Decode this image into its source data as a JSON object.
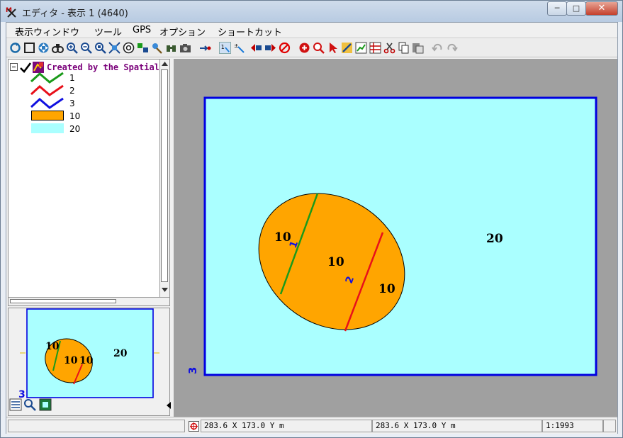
{
  "window": {
    "title": "エディタ - 表示 1 (4640)",
    "minimize": "─",
    "maximize": "□",
    "close": "✕"
  },
  "menubar": {
    "items": [
      "表示ウィンドウ",
      "ツール",
      "GPS",
      "オプション",
      "ショートカット"
    ]
  },
  "toolbar": {
    "icons": [
      "redraw-icon",
      "full-extent-icon",
      "pan-icon",
      "binoculars-icon",
      "zoom-in-icon",
      "zoom-out-icon",
      "zoom-box-icon",
      "zoom-layer-icon",
      "globe-icon",
      "measure-icon",
      "tool-icon",
      "find-icon",
      "camera-icon",
      "gps-icon",
      "select-icon",
      "move-label-icon",
      "previous-icon",
      "next-icon",
      "cancel-icon",
      "zoom-in-red-icon",
      "zoom-out-red-icon",
      "pointer-icon",
      "edit-icon",
      "chart-icon",
      "table-icon",
      "cut-icon",
      "copy-icon",
      "paste-icon",
      "undo-icon",
      "redo-icon"
    ]
  },
  "legend": {
    "layer_title": "Created by the Spatial E",
    "items": [
      {
        "label": "1",
        "color": "#1a9a1a",
        "kind": "line"
      },
      {
        "label": "2",
        "color": "#e8101a",
        "kind": "line"
      },
      {
        "label": "3",
        "color": "#1010e0",
        "kind": "line"
      },
      {
        "label": "10",
        "color": "#ffa500",
        "kind": "fill"
      },
      {
        "label": "20",
        "color": "#aaffff",
        "kind": "fill"
      }
    ]
  },
  "map": {
    "background_color": "#aaffff",
    "ellipse_color": "#ffa500",
    "border_color": "#0000e0",
    "labels": {
      "outer": "20",
      "left_piece": "10",
      "middle_piece": "10",
      "right_piece": "10",
      "node_a": "1",
      "node_b": "2",
      "node_c": "3"
    }
  },
  "overview": {
    "labels": {
      "outer": "20",
      "left_piece": "10",
      "middle_piece": "10",
      "right_piece": "10",
      "node_c": "3"
    }
  },
  "status": {
    "coord1": "283.6 X  173.0 Y m",
    "coord2": "283.6 X  173.0 Y m",
    "scale": "1:1993"
  }
}
